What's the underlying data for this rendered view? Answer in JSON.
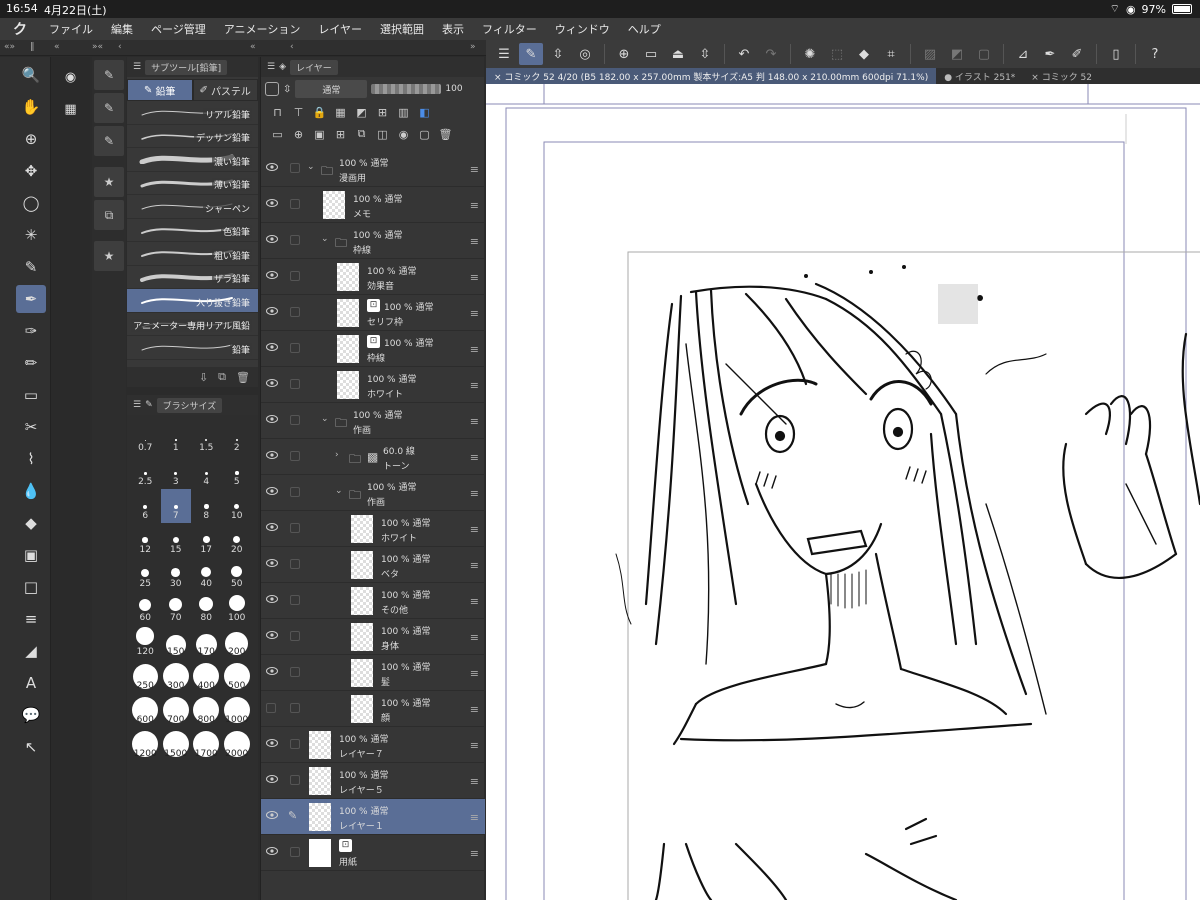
{
  "status": {
    "time": "16:54",
    "date": "4月22日(土)",
    "battery": "97%"
  },
  "menu": {
    "logo": "ク",
    "items": [
      "ファイル",
      "編集",
      "ページ管理",
      "アニメーション",
      "レイヤー",
      "選択範囲",
      "表示",
      "フィルター",
      "ウィンドウ",
      "ヘルプ"
    ]
  },
  "tools": [
    "🔍",
    "✋",
    "⊕",
    "✥",
    "◯",
    "✳",
    "✎",
    "✒",
    "✑",
    "✏",
    "▭",
    "✂",
    "⌇",
    "💧",
    "◆",
    "▣",
    "□",
    "≡",
    "◢",
    "A",
    "💬",
    "↖"
  ],
  "subtool": {
    "title": "サブツール[鉛筆]",
    "tabs": [
      "鉛筆",
      "パステル"
    ],
    "brushes": [
      "リアル鉛筆",
      "デッサン鉛筆",
      "濃い鉛筆",
      "薄い鉛筆",
      "シャーペン",
      "色鉛筆",
      "粗い鉛筆",
      "ザラ鉛筆",
      "入り抜き鉛筆",
      "アニメーター専用リアル風鉛",
      "鉛筆"
    ],
    "selected_index": 8
  },
  "brushsize": {
    "title": "ブラシサイズ",
    "sizes": [
      "0.7",
      "1",
      "1.5",
      "2",
      "2.5",
      "3",
      "4",
      "5",
      "6",
      "7",
      "8",
      "10",
      "12",
      "15",
      "17",
      "20",
      "25",
      "30",
      "40",
      "50",
      "60",
      "70",
      "80",
      "100",
      "120",
      "150",
      "170",
      "200",
      "250",
      "300",
      "400",
      "500",
      "600",
      "700",
      "800",
      "1000",
      "1200",
      "1500",
      "1700",
      "2000"
    ],
    "selected": "7"
  },
  "layers_panel": {
    "title": "レイヤー",
    "blend_mode": "通常",
    "opacity": "100"
  },
  "layers": [
    {
      "opacity": "100 %",
      "mode": "通常",
      "name": "漫画用",
      "type": "folder",
      "indent": 0,
      "visible": true
    },
    {
      "opacity": "100 %",
      "mode": "通常",
      "name": "メモ",
      "type": "raster",
      "indent": 1,
      "visible": true
    },
    {
      "opacity": "100 %",
      "mode": "通常",
      "name": "枠線",
      "type": "folder",
      "indent": 1,
      "visible": true
    },
    {
      "opacity": "100 %",
      "mode": "通常",
      "name": "効果音",
      "type": "raster",
      "indent": 2,
      "visible": true
    },
    {
      "opacity": "100 %",
      "mode": "通常",
      "name": "セリフ枠",
      "type": "raster",
      "indent": 2,
      "visible": true,
      "marker": true
    },
    {
      "opacity": "100 %",
      "mode": "通常",
      "name": "枠線",
      "type": "raster",
      "indent": 2,
      "visible": true,
      "marker": true
    },
    {
      "opacity": "100 %",
      "mode": "通常",
      "name": "ホワイト",
      "type": "raster",
      "indent": 2,
      "visible": true
    },
    {
      "opacity": "100 %",
      "mode": "通常",
      "name": "作画",
      "type": "folder",
      "indent": 1,
      "visible": true
    },
    {
      "opacity": "60.0 線",
      "mode": "",
      "name": "トーン",
      "type": "tone",
      "indent": 2,
      "visible": true
    },
    {
      "opacity": "100 %",
      "mode": "通常",
      "name": "作画",
      "type": "folder",
      "indent": 2,
      "visible": true
    },
    {
      "opacity": "100 %",
      "mode": "通常",
      "name": "ホワイト",
      "type": "raster",
      "indent": 3,
      "visible": true
    },
    {
      "opacity": "100 %",
      "mode": "通常",
      "name": "ベタ",
      "type": "raster",
      "indent": 3,
      "visible": true
    },
    {
      "opacity": "100 %",
      "mode": "通常",
      "name": "その他",
      "type": "raster",
      "indent": 3,
      "visible": true
    },
    {
      "opacity": "100 %",
      "mode": "通常",
      "name": "身体",
      "type": "raster",
      "indent": 3,
      "visible": true
    },
    {
      "opacity": "100 %",
      "mode": "通常",
      "name": "髪",
      "type": "raster",
      "indent": 3,
      "visible": true
    },
    {
      "opacity": "100 %",
      "mode": "通常",
      "name": "顔",
      "type": "raster",
      "indent": 3,
      "visible": false
    },
    {
      "opacity": "100 %",
      "mode": "通常",
      "name": "レイヤー７",
      "type": "raster",
      "indent": 0,
      "visible": true
    },
    {
      "opacity": "100 %",
      "mode": "通常",
      "name": "レイヤー５",
      "type": "raster",
      "indent": 0,
      "visible": true
    },
    {
      "opacity": "100 %",
      "mode": "通常",
      "name": "レイヤー１",
      "type": "raster",
      "indent": 0,
      "visible": true,
      "selected": true,
      "editing": true
    },
    {
      "opacity": "",
      "mode": "",
      "name": "用紙",
      "type": "paper",
      "indent": 0,
      "visible": true,
      "marker": true
    }
  ],
  "doc_tabs": [
    {
      "label": "× コミック 52 4/20 (B5 182.00 x 257.00mm 製本サイズ:A5 判 148.00 x 210.00mm 600dpi 71.1%)",
      "active": true
    },
    {
      "label": "● イラスト 251*",
      "active": false
    },
    {
      "label": "× コミック 52",
      "active": false
    }
  ]
}
